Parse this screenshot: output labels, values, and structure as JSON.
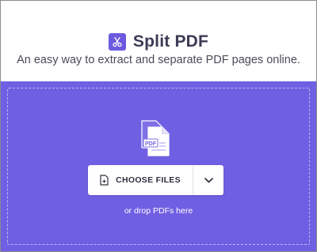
{
  "header": {
    "title": "Split PDF",
    "subtitle": "An easy way to extract and separate PDF pages online.",
    "icon": "scissors-icon"
  },
  "dropzone": {
    "illustration_label": "PDF",
    "choose_button_label": "CHOOSE FILES",
    "dropdown_icon": "chevron-down-icon",
    "drop_hint": "or drop PDFs here"
  },
  "colors": {
    "accent": "#6f5fe2",
    "icon_bg": "#6b5ae0",
    "title_text": "#3b3b55"
  }
}
